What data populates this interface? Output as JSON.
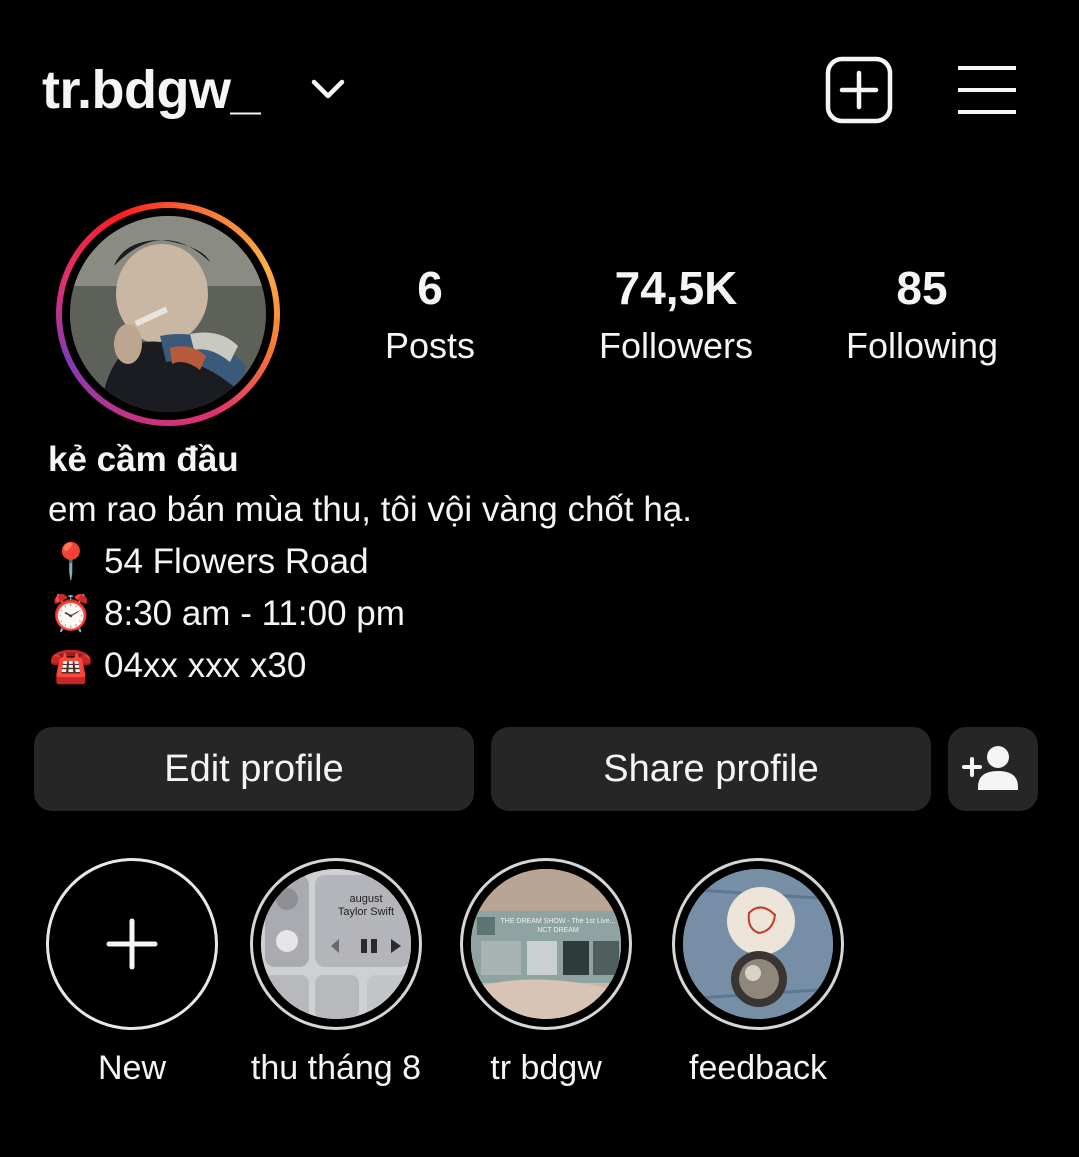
{
  "header": {
    "username": "tr.bdgw_",
    "icons": {
      "switch_account": "chevron-down-icon",
      "add_post": "plus-square-icon",
      "menu": "hamburger-menu-icon"
    }
  },
  "profile": {
    "avatar_icon": "profile-photo",
    "stats": [
      {
        "value": "6",
        "label": "Posts"
      },
      {
        "value": "74,5K",
        "label": "Followers"
      },
      {
        "value": "85",
        "label": "Following"
      }
    ],
    "name": "kẻ cầm đầu",
    "bio": {
      "tagline": "em rao bán mùa thu, tôi vội vàng chốt hạ.",
      "location_emoji": "📍",
      "location": "54 Flowers Road",
      "hours_emoji": "⏰",
      "hours": "8:30 am - 11:00 pm",
      "phone_emoji": "☎️",
      "phone": "04xx xxx x30"
    }
  },
  "actions": {
    "edit_label": "Edit profile",
    "share_label": "Share profile",
    "discover_icon": "add-person-icon"
  },
  "highlights": [
    {
      "label": "New"
    },
    {
      "label": "thu tháng 8",
      "card": {
        "title": "august",
        "artist": "Taylor Swift"
      }
    },
    {
      "label": "tr bdgw",
      "card": {
        "title": "THE DREAM SHOW - The 1st Live...",
        "artist": "NCT DREAM"
      }
    },
    {
      "label": "feedback"
    }
  ],
  "colors": {
    "background": "#000000",
    "text": "#f5f5f5",
    "button": "#262626",
    "story_ring": [
      "#c13584",
      "#e1306c",
      "#f77737",
      "#fcaf45"
    ]
  }
}
